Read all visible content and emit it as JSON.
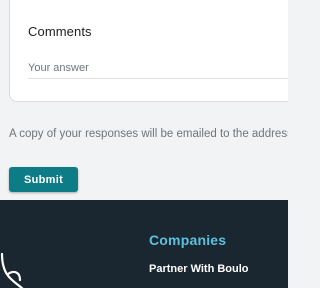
{
  "form": {
    "question_title": "Comments",
    "answer_placeholder": "Your answer",
    "answer_value": "",
    "email_note": "A copy of your responses will be emailed to the address",
    "submit_label": "Submit"
  },
  "footer": {
    "logo_icon": "brand-logo-icon",
    "section_heading": "Companies",
    "links": [
      {
        "label": "Partner With Boulo"
      }
    ]
  },
  "colors": {
    "submit_bg": "#0e7c86",
    "footer_bg": "#1b2730",
    "footer_heading": "#5bc0de",
    "page_bg": "#f1f3f4"
  }
}
